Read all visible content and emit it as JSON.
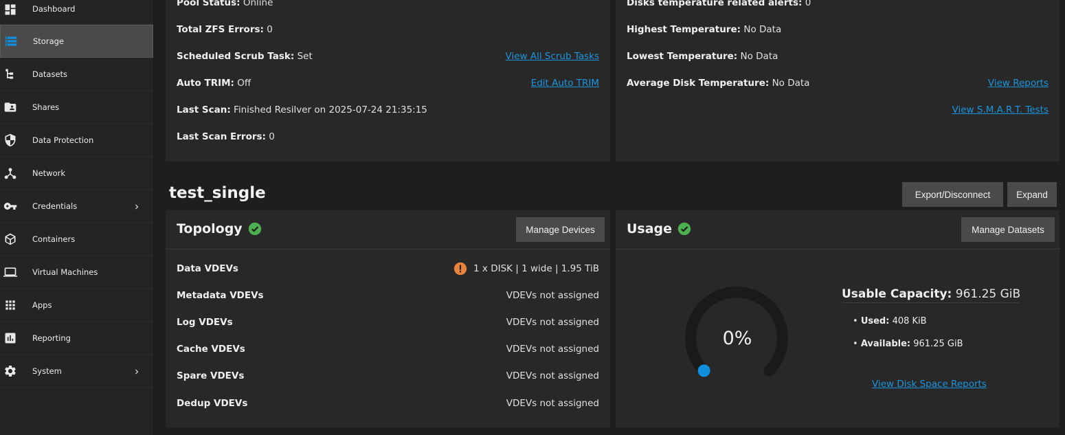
{
  "sidebar": {
    "items": [
      {
        "label": "Dashboard"
      },
      {
        "label": "Storage"
      },
      {
        "label": "Datasets"
      },
      {
        "label": "Shares"
      },
      {
        "label": "Data Protection"
      },
      {
        "label": "Network"
      },
      {
        "label": "Credentials"
      },
      {
        "label": "Containers"
      },
      {
        "label": "Virtual Machines"
      },
      {
        "label": "Apps"
      },
      {
        "label": "Reporting"
      },
      {
        "label": "System"
      }
    ],
    "active": "Storage"
  },
  "zfs_health": {
    "pool_status_label": "Pool Status:",
    "pool_status_value": "Online",
    "total_errors_label": "Total ZFS Errors:",
    "total_errors_value": "0",
    "scrub_label": "Scheduled Scrub Task:",
    "scrub_value": "Set",
    "scrub_link": "View All Scrub Tasks",
    "trim_label": "Auto TRIM:",
    "trim_value": "Off",
    "trim_link": "Edit Auto TRIM",
    "last_scan_label": "Last Scan:",
    "last_scan_value": "Finished Resilver on 2025-07-24 21:35:15",
    "last_scan_errors_label": "Last Scan Errors:",
    "last_scan_errors_value": "0"
  },
  "disk_health": {
    "temp_alerts_label": "Disks temperature related alerts:",
    "temp_alerts_value": "0",
    "highest_label": "Highest Temperature:",
    "highest_value": "No Data",
    "lowest_label": "Lowest Temperature:",
    "lowest_value": "No Data",
    "average_label": "Average Disk Temperature:",
    "average_value": "No Data",
    "reports_link": "View Reports",
    "smart_link": "View S.M.A.R.T. Tests"
  },
  "pool": {
    "name": "test_single",
    "export_label": "Export/Disconnect",
    "expand_label": "Expand"
  },
  "topology": {
    "title": "Topology",
    "manage_label": "Manage Devices",
    "rows": [
      {
        "label": "Data VDEVs",
        "value": "1 x DISK | 1 wide | 1.95 TiB",
        "warn": true
      },
      {
        "label": "Metadata VDEVs",
        "value": "VDEVs not assigned"
      },
      {
        "label": "Log VDEVs",
        "value": "VDEVs not assigned"
      },
      {
        "label": "Cache VDEVs",
        "value": "VDEVs not assigned"
      },
      {
        "label": "Spare VDEVs",
        "value": "VDEVs not assigned"
      },
      {
        "label": "Dedup VDEVs",
        "value": "VDEVs not assigned"
      }
    ]
  },
  "usage": {
    "title": "Usage",
    "manage_label": "Manage Datasets",
    "percent_text": "0%",
    "percent_value": 0,
    "capacity_label": "Usable Capacity:",
    "capacity_value": "961.25 GiB",
    "used_label": "Used:",
    "used_value": "408 KiB",
    "available_label": "Available:",
    "available_value": "961.25 GiB",
    "reports_link": "View Disk Space Reports"
  },
  "colors": {
    "accent": "#0f8ede",
    "ok": "#4caf50",
    "warn": "#e8833a",
    "link": "#1a96de"
  }
}
